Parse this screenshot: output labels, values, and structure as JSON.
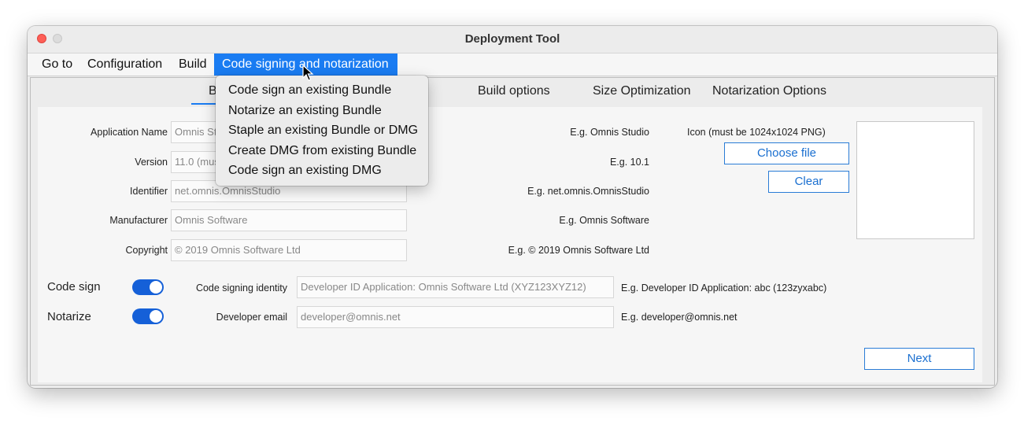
{
  "window": {
    "title": "Deployment Tool"
  },
  "menubar": {
    "items": [
      {
        "label": "Go to"
      },
      {
        "label": "Configuration"
      },
      {
        "label": "Build"
      },
      {
        "label": "Code signing and notarization"
      }
    ]
  },
  "dropdown": {
    "items": [
      "Code sign an existing Bundle",
      "Notarize an existing Bundle",
      "Staple an existing Bundle or DMG",
      "Create DMG from existing Bundle",
      "Code sign an existing DMG"
    ]
  },
  "tabs": [
    {
      "label": "B"
    },
    {
      "label": "Build options"
    },
    {
      "label": "Size Optimization"
    },
    {
      "label": "Notarization Options"
    }
  ],
  "form": {
    "app_name": {
      "label": "Application Name",
      "value": "Omnis St",
      "hint": "E.g. Omnis Studio"
    },
    "version": {
      "label": "Version",
      "value": "11.0 (mus",
      "hint": "E.g. 10.1"
    },
    "identifier": {
      "label": "Identifier",
      "value": "net.omnis.OmnisStudio",
      "hint": "E.g. net.omnis.OmnisStudio"
    },
    "manufacturer": {
      "label": "Manufacturer",
      "value": "Omnis Software",
      "hint": "E.g. Omnis Software"
    },
    "copyright": {
      "label": "Copyright",
      "value": "© 2019 Omnis Software Ltd",
      "hint": "E.g. © 2019 Omnis Software Ltd"
    }
  },
  "icon": {
    "label": "Icon (must be 1024x1024 PNG)",
    "choose_label": "Choose file",
    "clear_label": "Clear"
  },
  "code_sign": {
    "label": "Code sign",
    "enabled": true,
    "identity_label": "Code signing identity",
    "identity_value": "Developer ID Application: Omnis Software Ltd (XYZ123XYZ12)",
    "identity_hint": "E.g. Developer ID Application: abc (123zyxabc)"
  },
  "notarize": {
    "label": "Notarize",
    "enabled": true,
    "email_label": "Developer email",
    "email_value": "developer@omnis.net",
    "email_hint": "E.g. developer@omnis.net"
  },
  "footer": {
    "next_label": "Next"
  },
  "colors": {
    "accent": "#1a7cf2",
    "toggle": "#1560d8",
    "close": "#fe5f57"
  }
}
